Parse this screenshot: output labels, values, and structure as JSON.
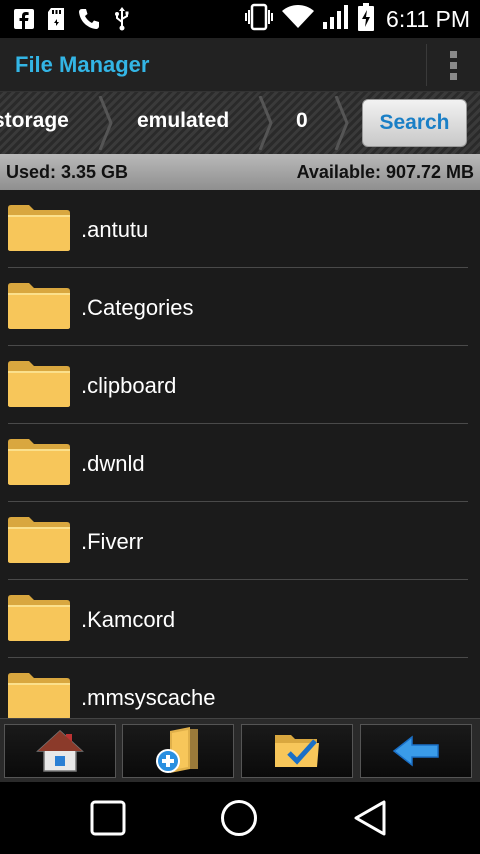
{
  "status_bar": {
    "time": "6:11 PM",
    "left_icons": [
      "facebook-icon",
      "sd-card-icon",
      "phone-icon",
      "usb-icon"
    ],
    "right_icons": [
      "vibrate-icon",
      "wifi-icon",
      "signal-icon",
      "battery-charging-icon"
    ]
  },
  "action_bar": {
    "title": "File Manager",
    "overflow_icon": "overflow-menu-icon"
  },
  "breadcrumb": {
    "items": [
      "storage",
      "emulated",
      "0"
    ],
    "search_label": "Search"
  },
  "usage": {
    "used": "Used: 3.35 GB",
    "available": "Available: 907.72 MB"
  },
  "files": [
    {
      "name": ".antutu",
      "icon": "folder-icon"
    },
    {
      "name": ".Categories",
      "icon": "folder-icon"
    },
    {
      "name": ".clipboard",
      "icon": "folder-icon"
    },
    {
      "name": ".dwnld",
      "icon": "folder-icon"
    },
    {
      "name": ".Fiverr",
      "icon": "folder-icon"
    },
    {
      "name": ".Kamcord",
      "icon": "folder-icon"
    },
    {
      "name": ".mmsyscache",
      "icon": "folder-icon"
    }
  ],
  "toolbar": {
    "buttons": [
      "home-icon",
      "new-folder-icon",
      "multi-select-icon",
      "back-arrow-icon"
    ]
  },
  "nav_bar": {
    "buttons": [
      "recents-icon",
      "home-circle-icon",
      "back-triangle-icon"
    ]
  },
  "colors": {
    "accent": "#33b5e5",
    "search_text": "#1a7fc6",
    "folder": "#f7c65a"
  }
}
